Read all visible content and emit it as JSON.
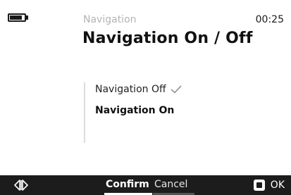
{
  "status_bar": {
    "battery_level": 0.85,
    "clock": "00:25"
  },
  "header": {
    "subtitle": "Navigation",
    "title": "Navigation On / Off"
  },
  "options": [
    {
      "label": "Navigation Off",
      "selected": true
    },
    {
      "label": "Navigation On",
      "selected": false
    }
  ],
  "bottom_bar": {
    "nav_icon": "left-right-arrows-icon",
    "confirm_label": "Confirm",
    "cancel_label": "Cancel",
    "ok_icon": "ok-button-icon",
    "ok_label": "OK"
  },
  "colors": {
    "background": "#ffffff",
    "bar": "#1c1c1c",
    "subtitle": "#b4b4b4",
    "checkmark": "#9a9a9a"
  }
}
